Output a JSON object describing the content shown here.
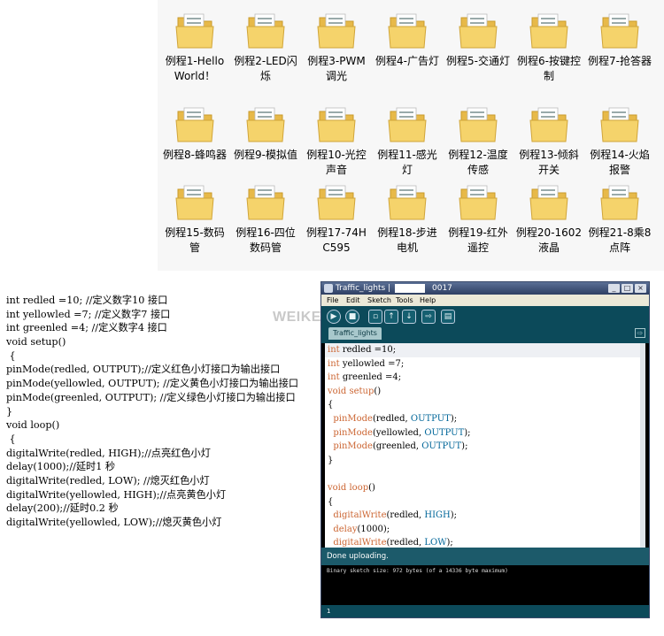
{
  "colors": {
    "folder": "#f2c94c",
    "ide_toolbar": "#0c4a5a",
    "ide_status": "#1c5a6a",
    "code_function": "#cc6633",
    "code_constant": "#006699"
  },
  "folders": [
    {
      "label": "例程1-Hello World！"
    },
    {
      "label": "例程2-LED闪烁"
    },
    {
      "label": "例程3-PWM调光"
    },
    {
      "label": "例程4-广告灯"
    },
    {
      "label": "例程5-交通灯"
    },
    {
      "label": "例程6-按键控制"
    },
    {
      "label": "例程7-抢答器"
    },
    {
      "label": "例程8-蜂鸣器"
    },
    {
      "label": "例程9-模拟值"
    },
    {
      "label": "例程10-光控声音"
    },
    {
      "label": "例程11-感光灯"
    },
    {
      "label": "例程12-温度传感"
    },
    {
      "label": "例程13-倾斜开关"
    },
    {
      "label": "例程14-火焰报警"
    },
    {
      "label": "例程15-数码管"
    },
    {
      "label": "例程16-四位数码管"
    },
    {
      "label": "例程17-74HC595"
    },
    {
      "label": "例程18-步进电机"
    },
    {
      "label": "例程19-红外遥控"
    },
    {
      "label": "例程20-1602液晶"
    },
    {
      "label": "例程21-8乘8点阵"
    }
  ],
  "code_listing": [
    "int redled =10; //定义数字10 接口",
    "int yellowled =7; //定义数字7 接口",
    "int greenled =4; //定义数字4 接口",
    "void setup()",
    " {",
    "pinMode(redled, OUTPUT);//定义红色小灯接口为输出接口",
    "pinMode(yellowled, OUTPUT); //定义黄色小灯接口为输出接口",
    "pinMode(greenled, OUTPUT); //定义绿色小灯接口为输出接口",
    "}",
    "void loop()",
    " {",
    "digitalWrite(redled, HIGH);//点亮红色小灯",
    "delay(1000);//延时1 秒",
    "digitalWrite(redled, LOW); //熄灭红色小灯",
    "digitalWrite(yellowled, HIGH);//点亮黄色小灯",
    "delay(200);//延时0.2 秒",
    "digitalWrite(yellowled, LOW);//熄灭黄色小灯"
  ],
  "watermark": "WEIKE",
  "ide": {
    "title": "Traffic_lights |",
    "title_suffix": "0017",
    "window_buttons": [
      "_",
      "□",
      "×"
    ],
    "menu": [
      "File",
      "Edit",
      "Sketch",
      "Tools",
      "Help"
    ],
    "toolbar_icons": [
      "verify-icon",
      "stop-icon",
      "new-icon",
      "open-icon",
      "save-icon",
      "upload-icon",
      "serial-monitor-icon"
    ],
    "tab": "Traffic_lights",
    "tab_menu_glyph": "⇨",
    "editor_lines": [
      "int redled =10;",
      "int yellowled =7;",
      "int greenled =4;",
      "void setup()",
      "{",
      "  pinMode(redled, OUTPUT);",
      "  pinMode(yellowled, OUTPUT);",
      "  pinMode(greenled, OUTPUT);",
      "}",
      "",
      "void loop()",
      "{",
      "  digitalWrite(redled, HIGH);",
      "  delay(1000);",
      "  digitalWrite(redled, LOW);"
    ],
    "status": "Done uploading.",
    "console": "Binary sketch size: 972 bytes (of a 14336 byte maximum)",
    "line_number": "1"
  }
}
